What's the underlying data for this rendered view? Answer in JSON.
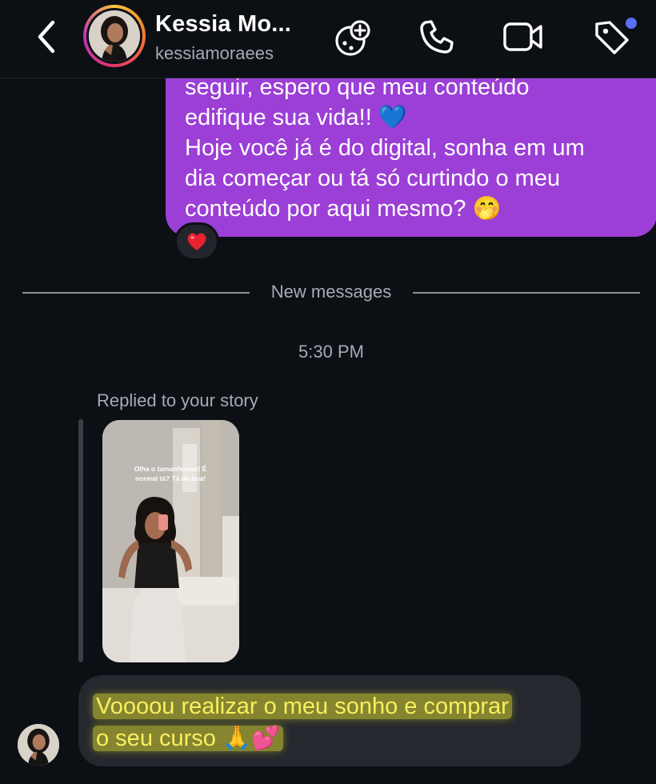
{
  "header": {
    "name": "Kessia Mo...",
    "username": "kessiamoraees",
    "icons": [
      "back-chevron-icon",
      "avatar",
      "game-controller-icon",
      "phone-icon",
      "video-camera-icon",
      "tag-icon"
    ],
    "notification_color": "#5b6ff7"
  },
  "sent_message": {
    "lines": [
      "seguir, espero que meu conteúdo",
      "edifique sua vida!! 💙",
      "Hoje você já é do digital, sonha em um",
      "dia começar ou tá só curtindo o meu",
      "conteúdo por aqui mesmo? 🤭"
    ],
    "reaction": "❤️",
    "bubble_color": "#9b3fd6"
  },
  "divider": {
    "label": "New messages"
  },
  "timestamp": "5:30 PM",
  "story_reply": {
    "label": "Replied to your story",
    "story_caption_line1": "Olha o tamanhoooo! É",
    "story_caption_line2": "normal tá? Tá de boa!"
  },
  "received_message": {
    "line1": "Voooou realizar o meu sonho e comprar",
    "line2": "o seu curso 🙏💕",
    "highlight_color": "#f8ef60"
  }
}
